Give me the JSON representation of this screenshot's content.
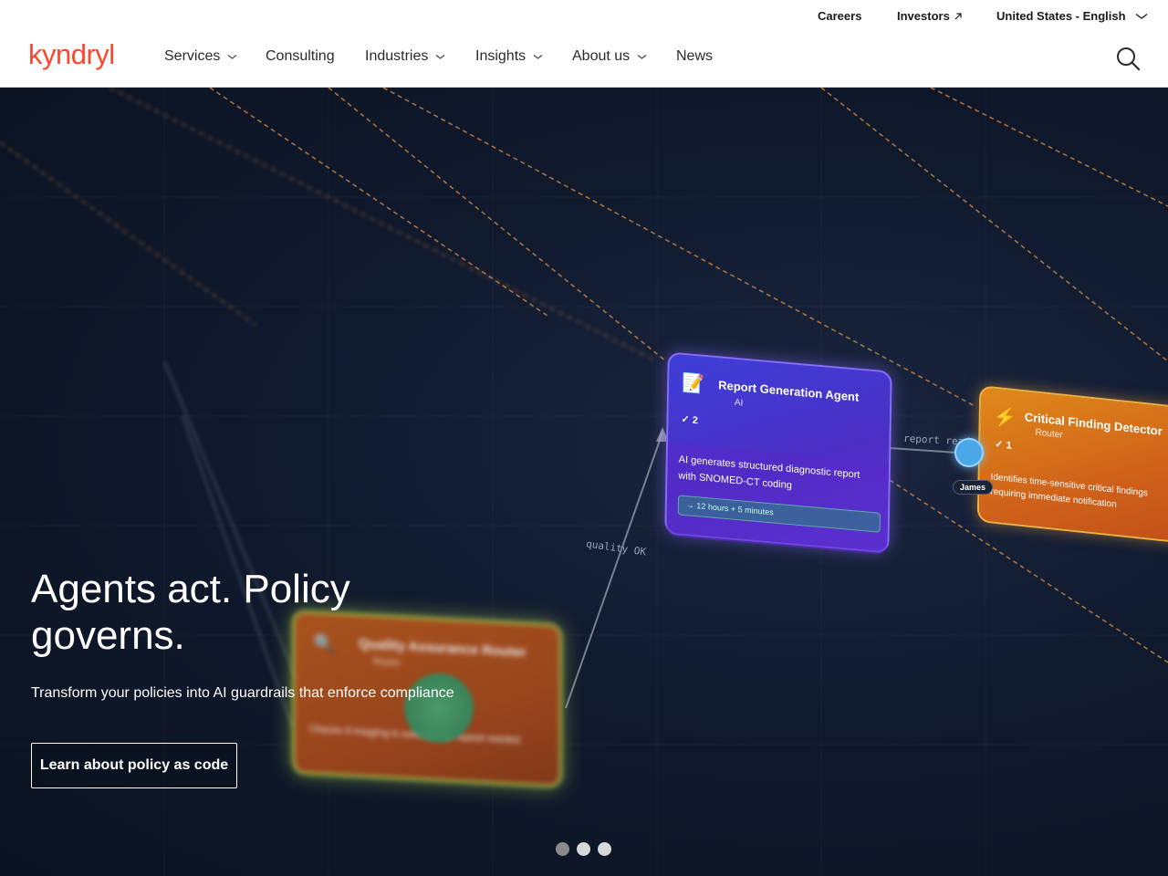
{
  "utility_nav": {
    "careers": "Careers",
    "investors": "Investors",
    "investors_icon": "external-arrow-icon",
    "locale": "United States - English",
    "locale_icon": "chevron-down-icon"
  },
  "brand": {
    "logo_text": "kyndryl",
    "logo_color": "#ff462d"
  },
  "main_nav": {
    "items": [
      {
        "label": "Services",
        "has_dropdown": true
      },
      {
        "label": "Consulting",
        "has_dropdown": false
      },
      {
        "label": "Industries",
        "has_dropdown": true
      },
      {
        "label": "Insights",
        "has_dropdown": true
      },
      {
        "label": "About us",
        "has_dropdown": true
      },
      {
        "label": "News",
        "has_dropdown": false
      }
    ],
    "search_icon": "search-icon"
  },
  "hero": {
    "title": "Agents act. Policy governs.",
    "subtitle": "Transform your policies into AI guardrails that enforce compliance",
    "cta_label": "Learn about policy as code",
    "carousel": {
      "slide_count": 3,
      "active_index": 0
    },
    "illustration": {
      "report_card": {
        "title": "Report Generation Agent",
        "type": "AI",
        "count": "✓ 2",
        "description": "AI generates structured diagnostic report with SNOMED-CT coding",
        "time": "→ 12 hours + 5 minutes"
      },
      "critical_card": {
        "title": "Critical Finding Detector",
        "type": "Router",
        "count": "✓ 1",
        "description": "Identifies time-sensitive critical findings requiring immediate notification"
      },
      "qa_card": {
        "title": "Quality Assurance Router",
        "type": "Router",
        "description": "Checks if imaging is sufficient or repeat needed"
      },
      "edge_labels": {
        "report_ready": "report ready",
        "quality_ok": "quality OK"
      },
      "avatar_name": "James"
    }
  }
}
